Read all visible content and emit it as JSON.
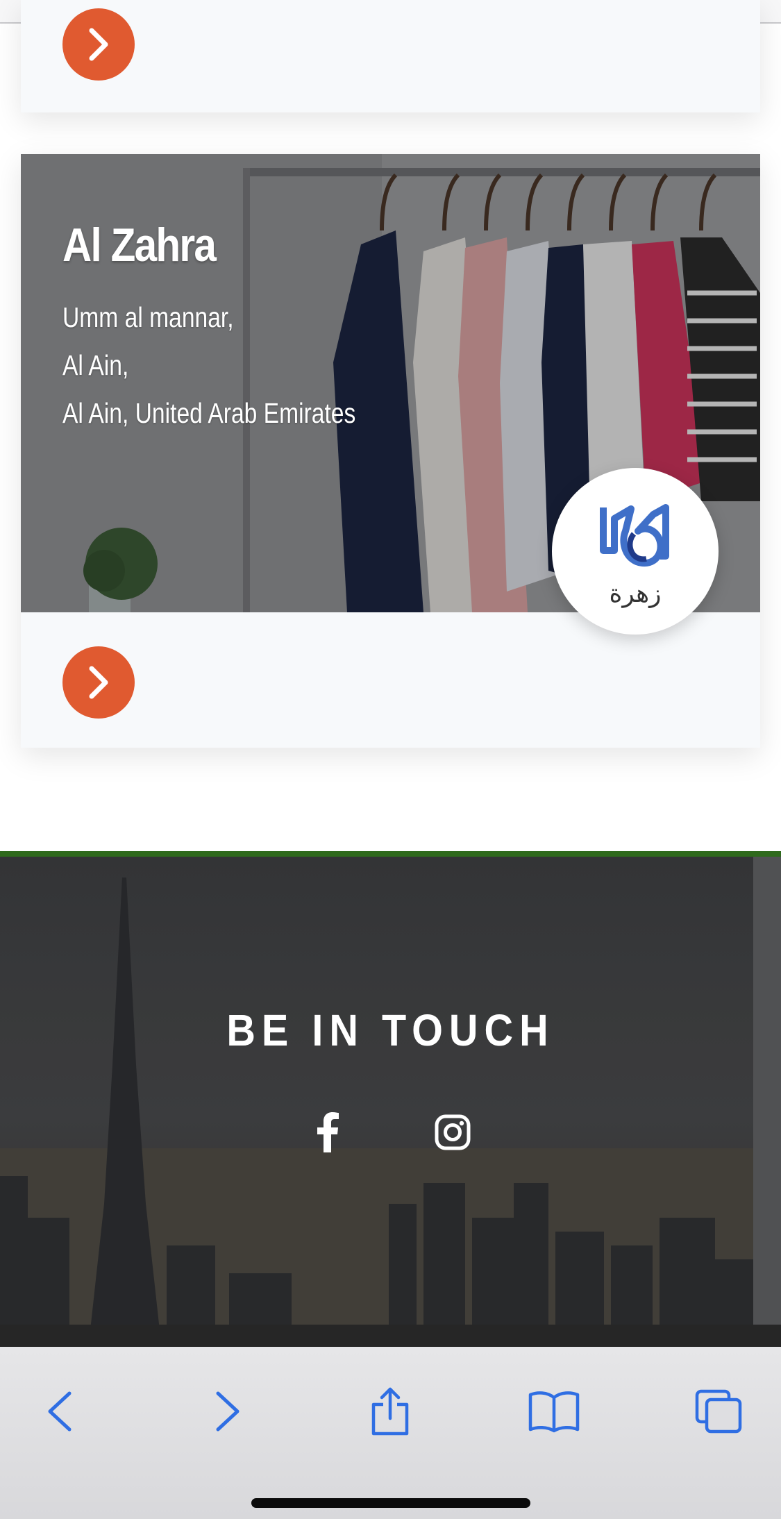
{
  "store": {
    "name": "Al Zahra",
    "address_lines": [
      "Umm al mannar,",
      "Al Ain,",
      "Al Ain, United Arab Emirates"
    ],
    "logo_text": "زهرة"
  },
  "footer": {
    "title": "BE IN TOUCH",
    "social": [
      "facebook-icon",
      "instagram-icon"
    ]
  },
  "colors": {
    "accent": "#e05a30",
    "footer_border": "#2f6a1d",
    "toolbar_icon": "#1a73e8"
  },
  "toolbar": {
    "icons": [
      "back-icon",
      "forward-icon",
      "share-icon",
      "bookmarks-icon",
      "tabs-icon"
    ]
  }
}
